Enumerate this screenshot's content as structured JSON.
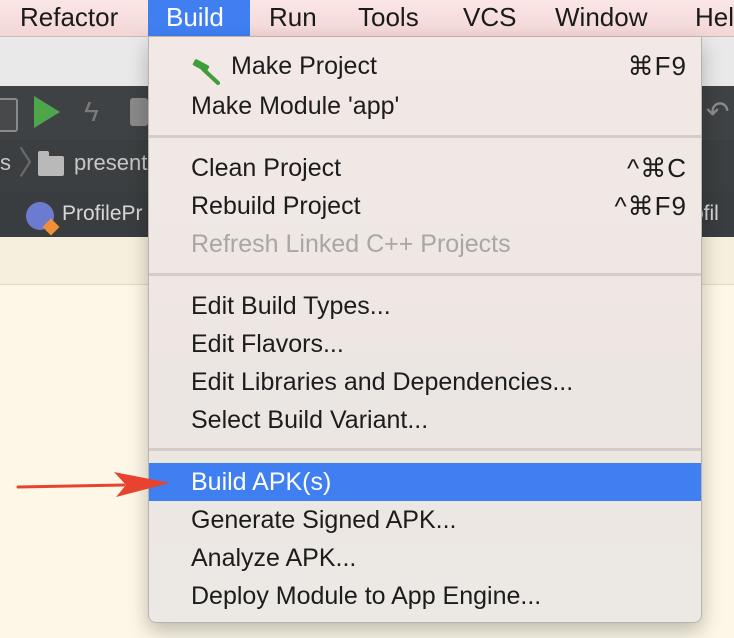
{
  "menubar": {
    "items": [
      {
        "label": "Refactor"
      },
      {
        "label": "Build"
      },
      {
        "label": "Run"
      },
      {
        "label": "Tools"
      },
      {
        "label": "VCS"
      },
      {
        "label": "Window"
      },
      {
        "label": "Hel"
      }
    ],
    "active_index": 1
  },
  "background": {
    "window_path_fragment": "[~/",
    "breadcrumb_left_fragment": "s",
    "breadcrumb_folder": "present",
    "file_tab_left": "ProfilePr",
    "file_tab_right": "ofil"
  },
  "build_menu": {
    "items": [
      {
        "label": "Make Project",
        "shortcut": "⌘F9",
        "icon": "hammer-icon"
      },
      {
        "label": "Make Module 'app'",
        "shortcut": ""
      },
      {
        "label": "Clean Project",
        "shortcut": "^⌘C"
      },
      {
        "label": "Rebuild Project",
        "shortcut": "^⌘F9"
      },
      {
        "label": "Refresh Linked C++ Projects",
        "shortcut": "",
        "disabled": true
      },
      {
        "label": "Edit Build Types...",
        "shortcut": ""
      },
      {
        "label": "Edit Flavors...",
        "shortcut": ""
      },
      {
        "label": "Edit Libraries and Dependencies...",
        "shortcut": ""
      },
      {
        "label": "Select Build Variant...",
        "shortcut": ""
      },
      {
        "label": "Build APK(s)",
        "shortcut": "",
        "highlighted": true
      },
      {
        "label": "Generate Signed APK...",
        "shortcut": ""
      },
      {
        "label": "Analyze APK...",
        "shortcut": ""
      },
      {
        "label": "Deploy Module to App Engine...",
        "shortcut": ""
      }
    ]
  },
  "colors": {
    "menu_highlight": "#3f7ff1",
    "annotation_arrow": "#e8432e",
    "hammer_green": "#3f9e3a"
  }
}
